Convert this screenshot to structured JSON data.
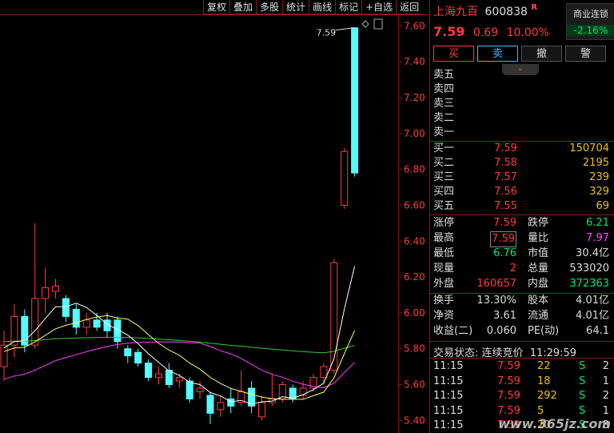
{
  "toolbar": [
    "复权",
    "叠加",
    "多股",
    "统计",
    "画线",
    "标记",
    "+自选",
    "返回"
  ],
  "chart": {
    "price_labels": [
      "7.60",
      "7.40",
      "7.20",
      "7.00",
      "6.80",
      "6.60",
      "6.40",
      "6.20",
      "6.00",
      "5.80",
      "5.60",
      "5.40"
    ],
    "high_marker": "7.59"
  },
  "chart_data": {
    "type": "candlestick",
    "ylim": [
      5.33,
      7.66
    ],
    "candles": [
      {
        "o": 5.7,
        "c": 5.82,
        "h": 5.9,
        "l": 5.62
      },
      {
        "o": 5.82,
        "c": 5.98,
        "h": 6.05,
        "l": 5.75
      },
      {
        "o": 5.98,
        "c": 5.82,
        "h": 6.02,
        "l": 5.78
      },
      {
        "o": 5.82,
        "c": 6.08,
        "h": 6.5,
        "l": 5.8
      },
      {
        "o": 6.08,
        "c": 6.14,
        "h": 6.25,
        "l": 6.0
      },
      {
        "o": 6.12,
        "c": 6.15,
        "h": 6.19,
        "l": 6.08
      },
      {
        "o": 6.08,
        "c": 5.98,
        "h": 6.1,
        "l": 5.95
      },
      {
        "o": 6.02,
        "c": 5.92,
        "h": 6.05,
        "l": 5.88
      },
      {
        "o": 5.92,
        "c": 5.96,
        "h": 6.0,
        "l": 5.88
      },
      {
        "o": 5.96,
        "c": 5.92,
        "h": 6.0,
        "l": 5.9
      },
      {
        "o": 5.96,
        "c": 5.9,
        "h": 6.0,
        "l": 5.86
      },
      {
        "o": 5.96,
        "c": 5.84,
        "h": 5.98,
        "l": 5.8
      },
      {
        "o": 5.8,
        "c": 5.76,
        "h": 5.82,
        "l": 5.72
      },
      {
        "o": 5.78,
        "c": 5.72,
        "h": 5.8,
        "l": 5.7
      },
      {
        "o": 5.72,
        "c": 5.64,
        "h": 5.74,
        "l": 5.62
      },
      {
        "o": 5.64,
        "c": 5.66,
        "h": 5.7,
        "l": 5.6
      },
      {
        "o": 5.68,
        "c": 5.6,
        "h": 5.72,
        "l": 5.58
      },
      {
        "o": 5.62,
        "c": 5.64,
        "h": 5.66,
        "l": 5.58
      },
      {
        "o": 5.62,
        "c": 5.52,
        "h": 5.64,
        "l": 5.5
      },
      {
        "o": 5.56,
        "c": 5.58,
        "h": 5.62,
        "l": 5.52
      },
      {
        "o": 5.54,
        "c": 5.44,
        "h": 5.56,
        "l": 5.38
      },
      {
        "o": 5.46,
        "c": 5.5,
        "h": 5.54,
        "l": 5.42
      },
      {
        "o": 5.52,
        "c": 5.48,
        "h": 5.58,
        "l": 5.44
      },
      {
        "o": 5.5,
        "c": 5.56,
        "h": 5.68,
        "l": 5.48
      },
      {
        "o": 5.58,
        "c": 5.48,
        "h": 5.62,
        "l": 5.44
      },
      {
        "o": 5.42,
        "c": 5.5,
        "h": 5.54,
        "l": 5.4
      },
      {
        "o": 5.5,
        "c": 5.52,
        "h": 5.66,
        "l": 5.48
      },
      {
        "o": 5.52,
        "c": 5.6,
        "h": 5.62,
        "l": 5.5
      },
      {
        "o": 5.58,
        "c": 5.52,
        "h": 5.6,
        "l": 5.5
      },
      {
        "o": 5.54,
        "c": 5.58,
        "h": 5.62,
        "l": 5.52
      },
      {
        "o": 5.58,
        "c": 5.64,
        "h": 5.66,
        "l": 5.56
      },
      {
        "o": 5.64,
        "c": 5.7,
        "h": 5.72,
        "l": 5.6
      },
      {
        "o": 5.68,
        "c": 6.28,
        "h": 6.3,
        "l": 5.66
      },
      {
        "o": 6.6,
        "c": 6.9,
        "h": 6.92,
        "l": 6.58
      },
      {
        "o": 7.59,
        "c": 6.78,
        "h": 7.59,
        "l": 6.76
      }
    ]
  },
  "stock": {
    "name": "上海九百",
    "code": "600838",
    "r_mark": "R",
    "price": "7.59",
    "change": "0.69",
    "change_pct": "10.00%",
    "sector_name": "商业连锁",
    "sector_change": "-2.16%"
  },
  "trade_buttons": {
    "buy": "买",
    "sell": "卖",
    "cancel": "撤",
    "alert": "警"
  },
  "asks": [
    {
      "label": "卖五",
      "price": "",
      "vol": ""
    },
    {
      "label": "卖四",
      "price": "",
      "vol": ""
    },
    {
      "label": "卖三",
      "price": "",
      "vol": ""
    },
    {
      "label": "卖二",
      "price": "",
      "vol": ""
    },
    {
      "label": "卖一",
      "price": "",
      "vol": ""
    }
  ],
  "bids": [
    {
      "label": "买一",
      "price": "7.59",
      "vol": "150704"
    },
    {
      "label": "买二",
      "price": "7.58",
      "vol": "2195"
    },
    {
      "label": "买三",
      "price": "7.57",
      "vol": "239"
    },
    {
      "label": "买四",
      "price": "7.56",
      "vol": "329"
    },
    {
      "label": "买五",
      "price": "7.55",
      "vol": "69"
    }
  ],
  "stats1": [
    {
      "l1": "涨停",
      "v1": "7.59",
      "l2": "跌停",
      "v2": "6.21"
    },
    {
      "l1": "最高",
      "v1": "7.59",
      "l2": "量比",
      "v2": "7.97"
    },
    {
      "l1": "最低",
      "v1": "6.76",
      "l2": "市值",
      "v2": "30.4亿"
    },
    {
      "l1": "现量",
      "v1": "2",
      "l2": "总量",
      "v2": "533020"
    },
    {
      "l1": "外盘",
      "v1": "160657",
      "l2": "内盘",
      "v2": "372363"
    }
  ],
  "stats2": [
    {
      "l1": "换手",
      "v1": "13.30%",
      "l2": "股本",
      "v2": "4.01亿"
    },
    {
      "l1": "净资",
      "v1": "3.61",
      "l2": "流通",
      "v2": "4.01亿"
    },
    {
      "l1": "收益(二)",
      "v1": "0.060",
      "l2": "PE(动)",
      "v2": "64.1"
    }
  ],
  "status": {
    "label": "交易状态:",
    "value": "连续竞价",
    "time": "11:29:59"
  },
  "ticks": [
    {
      "time": "11:15",
      "price": "7.59",
      "vol": "22",
      "side": "S",
      "n": "2"
    },
    {
      "time": "11:15",
      "price": "7.59",
      "vol": "18",
      "side": "S",
      "n": "1"
    },
    {
      "time": "11:15",
      "price": "7.59",
      "vol": "292",
      "side": "S",
      "n": "2"
    },
    {
      "time": "11:15",
      "price": "7.59",
      "vol": "5",
      "side": "S",
      "n": "1"
    },
    {
      "time": "11:15",
      "price": "7.59",
      "vol": "20",
      "side": "S",
      "n": "3"
    }
  ],
  "watermark": "www.365jz.com",
  "colors": {
    "up": "#ff3b3b",
    "down": "#54ffff",
    "ma5": "#ffffff",
    "ma10": "#ffff66",
    "ma20": "#ff40ff",
    "ma60": "#33cc33"
  }
}
